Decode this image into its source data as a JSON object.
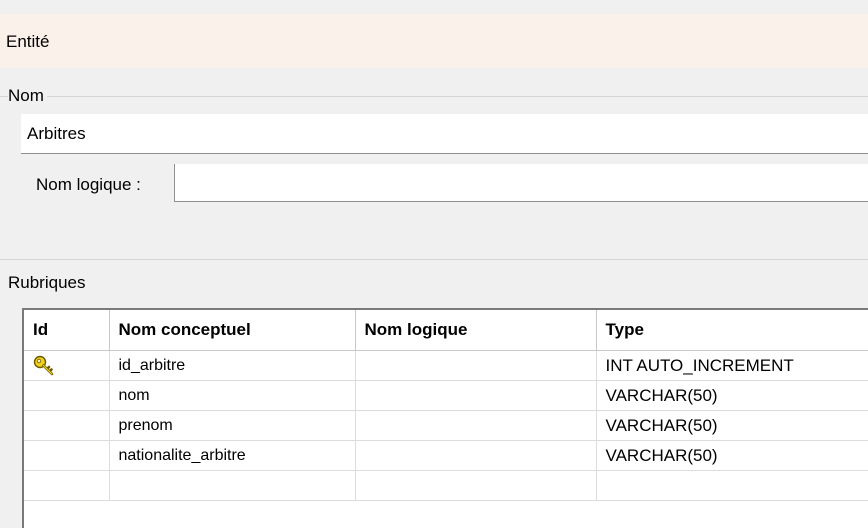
{
  "entity_title": "Entité",
  "name_group": {
    "label": "Nom",
    "value": "Arbitres",
    "logical_label": "Nom logique :",
    "logical_value": ""
  },
  "fields_group": {
    "label": "Rubriques",
    "columns": [
      "Id",
      "Nom conceptuel",
      "Nom logique",
      "Type"
    ],
    "rows": [
      {
        "is_key": true,
        "icon": "key-icon",
        "name": "id_arbitre",
        "logical": "",
        "type": "INT AUTO_INCREMENT"
      },
      {
        "is_key": false,
        "name": "nom",
        "logical": "",
        "type": "VARCHAR(50)"
      },
      {
        "is_key": false,
        "name": "prenom",
        "logical": "",
        "type": "VARCHAR(50)"
      },
      {
        "is_key": false,
        "name": "nationalite_arbitre",
        "logical": "",
        "type": "VARCHAR(50)"
      },
      {
        "is_key": false,
        "name": "",
        "logical": "",
        "type": ""
      }
    ]
  }
}
